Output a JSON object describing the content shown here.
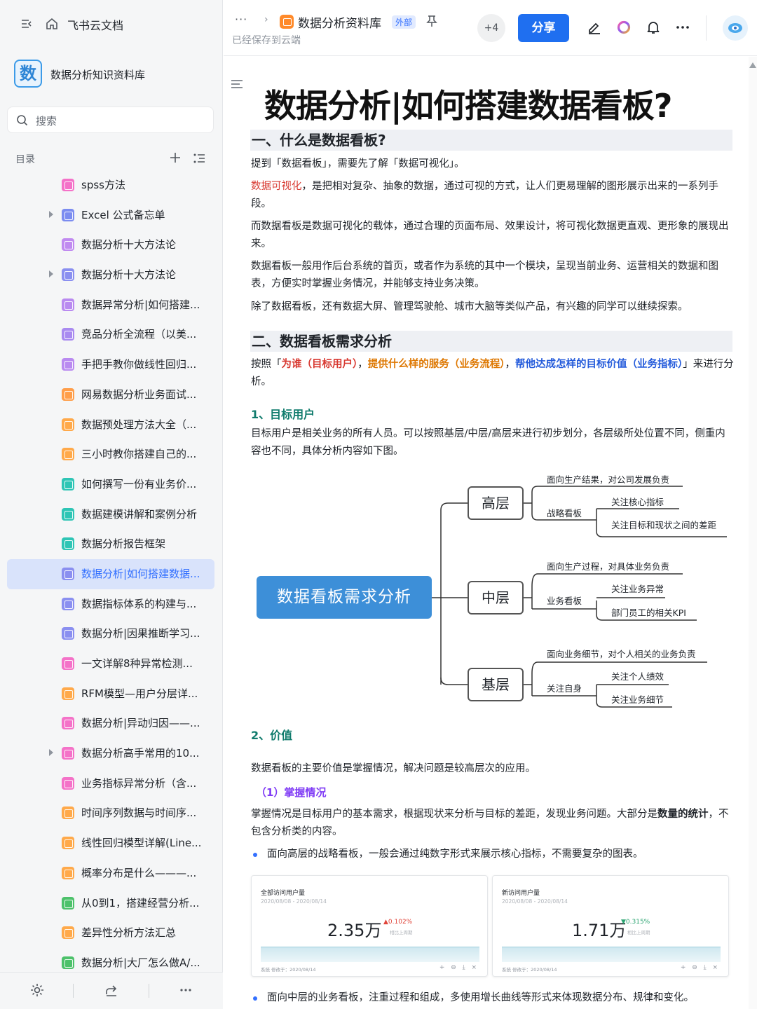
{
  "sidebar": {
    "brand": "飞书云文档",
    "library_badge": "数",
    "library_name": "数据分析知识资料库",
    "search_placeholder": "搜索",
    "toc_label": "目录",
    "items": [
      {
        "label": "spss方法",
        "color": "#f472c8",
        "caret": false,
        "active": false
      },
      {
        "label": "Excel 公式备忘单",
        "color": "#7b8cf0",
        "caret": true,
        "active": false
      },
      {
        "label": "数据分析十大方法论",
        "color": "#c08af0",
        "caret": false,
        "active": false
      },
      {
        "label": "数据分析十大方法论",
        "color": "#8a8ff0",
        "caret": true,
        "active": false
      },
      {
        "label": "数据异常分析|如何搭建...",
        "color": "#b98af0",
        "caret": false,
        "active": false
      },
      {
        "label": "竞品分析全流程（以美...",
        "color": "#a98af0",
        "caret": false,
        "active": false
      },
      {
        "label": "手把手教你做线性回归...",
        "color": "#b98af0",
        "caret": false,
        "active": false
      },
      {
        "label": "网易数据分析业务面试...",
        "color": "#ff9e4a",
        "caret": false,
        "active": false
      },
      {
        "label": "数据预处理方法大全（...",
        "color": "#ffa94a",
        "caret": false,
        "active": false
      },
      {
        "label": "三小时教你搭建自己的...",
        "color": "#ffa94a",
        "caret": false,
        "active": false
      },
      {
        "label": "如何撰写一份有业务价...",
        "color": "#2ec5b5",
        "caret": false,
        "active": false
      },
      {
        "label": "数据建模讲解和案例分析",
        "color": "#2ec5b5",
        "caret": false,
        "active": false
      },
      {
        "label": "数据分析报告框架",
        "color": "#2ec5b5",
        "caret": false,
        "active": false
      },
      {
        "label": "数据分析|如何搭建数据...",
        "color": "#8a8ff0",
        "caret": false,
        "active": true
      },
      {
        "label": "数据指标体系的构建与...",
        "color": "#8a8ff0",
        "caret": false,
        "active": false
      },
      {
        "label": "数据分析|因果推断学习...",
        "color": "#8a8ff0",
        "caret": false,
        "active": false
      },
      {
        "label": "一文详解8种异常检测...",
        "color": "#f472c8",
        "caret": false,
        "active": false
      },
      {
        "label": "RFM模型—用户分层详...",
        "color": "#ffa94a",
        "caret": false,
        "active": false
      },
      {
        "label": "数据分析|异动归因——...",
        "color": "#f472c8",
        "caret": false,
        "active": false
      },
      {
        "label": "数据分析高手常用的10...",
        "color": "#f472c8",
        "caret": true,
        "active": false
      },
      {
        "label": "业务指标异常分析（含...",
        "color": "#f472c8",
        "caret": false,
        "active": false
      },
      {
        "label": "时间序列数据与时间序...",
        "color": "#ffa94a",
        "caret": false,
        "active": false
      },
      {
        "label": "线性回归模型详解(Line...",
        "color": "#ffa94a",
        "caret": false,
        "active": false
      },
      {
        "label": "概率分布是什么———...",
        "color": "#ffa94a",
        "caret": false,
        "active": false
      },
      {
        "label": "从0到1，搭建经营分析...",
        "color": "#4cc16a",
        "caret": false,
        "active": false
      },
      {
        "label": "差异性分析方法汇总",
        "color": "#ffa94a",
        "caret": false,
        "active": false
      },
      {
        "label": "数据分析|大厂怎么做A/...",
        "color": "#4cc16a",
        "caret": false,
        "active": false
      }
    ]
  },
  "header": {
    "library_name": "数据分析资料库",
    "external_tag": "外部",
    "saved_status": "已经保存到云端",
    "collaborators": "+4",
    "share_label": "分享"
  },
  "doc": {
    "title": "数据分析|如何搭建数据看板?",
    "s1_heading": "一、什么是数据看板?",
    "s1_p1": "提到「数据看板」，需要先了解「数据可视化」。",
    "s1_p2_red": "数据可视化",
    "s1_p2_rest": "，是把相对复杂、抽象的数据，通过可视的方式，让人们更易理解的图形展示出来的一系列手段。",
    "s1_p3": "而数据看板是数据可视化的载体，通过合理的页面布局、效果设计，将可视化数据更直观、更形象的展现出来。",
    "s1_p4": "数据看板一般用作后台系统的首页，或者作为系统的其中一个模块，呈现当前业务、运营相关的数据和图表，方便实时掌握业务情况，并能够支持业务决策。",
    "s1_p5": "除了数据看板，还有数据大屏、管理驾驶舱、城市大脑等类似产品，有兴趣的同学可以继续探索。",
    "s2_heading": "二、数据看板需求分析",
    "s2_p1_a": "按照「",
    "s2_p1_red": "为谁（目标用户）",
    "s2_p1_b": "，",
    "s2_p1_orange": "提供什么样的服务（业务流程）",
    "s2_p1_c": "，",
    "s2_p1_blue": "帮他达成怎样的目标价值（业务指标）",
    "s2_p1_d": "」来进行分析。",
    "h3_users": "1、目标用户",
    "users_p": "目标用户是相关业务的所有人员。可以按照基层/中层/高层来进行初步划分，各层级所处位置不同，侧重内容也不同，具体分析内容如下图。",
    "mindmap": {
      "root": "数据看板需求分析",
      "high": {
        "label": "高层",
        "desc": "面向生产结果，对公司发展负责",
        "board": "战略看板",
        "items": [
          "关注核心指标",
          "关注目标和现状之间的差距"
        ]
      },
      "mid": {
        "label": "中层",
        "desc": "面向生产过程，对具体业务负责",
        "board": "业务看板",
        "items": [
          "关注业务异常",
          "部门员工的相关KPI"
        ]
      },
      "base": {
        "label": "基层",
        "desc": "面向业务细节，对个人相关的业务负责",
        "board": "关注自身",
        "items": [
          "关注个人绩效",
          "关注业务细节"
        ]
      }
    },
    "h3_value": "2、价值",
    "value_p": "数据看板的主要价值是掌握情况，解决问题是较高层次的应用。",
    "h4_grasp": "（1）掌握情况",
    "grasp_p_a": "掌握情况是目标用户的基本需求，根据现状来分析与目标的差距，发现业务问题。大部分是",
    "grasp_p_bold": "数量的统计",
    "grasp_p_b": "，不包含分析类的内容。",
    "bullet1": "面向高层的战略看板，一般会通过纯数字形式来展示核心指标，不需要复杂的图表。",
    "bullet2": "面向中层的业务看板，注重过程和组成，多使用增长曲线等形式来体现数据分布、规律和变化。",
    "cards": [
      {
        "title": "全部访问用户量",
        "range": "2020/08/08 - 2020/08/14",
        "value": "2.35万",
        "change": "▲0.102%",
        "change_color": "#e0453a",
        "sub": "相比上周期",
        "footer": "系统  修改于：2020/08/14",
        "icons": "+ ⊖ ⤓ ×"
      },
      {
        "title": "新访问用户量",
        "range": "2020/08/08 - 2020/08/14",
        "value": "1.71万",
        "change": "▼0.315%",
        "change_color": "#2ba471",
        "sub": "相比上周期",
        "footer": "系统  修改于：2020/08/14",
        "icons": "+ ⊖ ⤓ ×"
      }
    ]
  }
}
